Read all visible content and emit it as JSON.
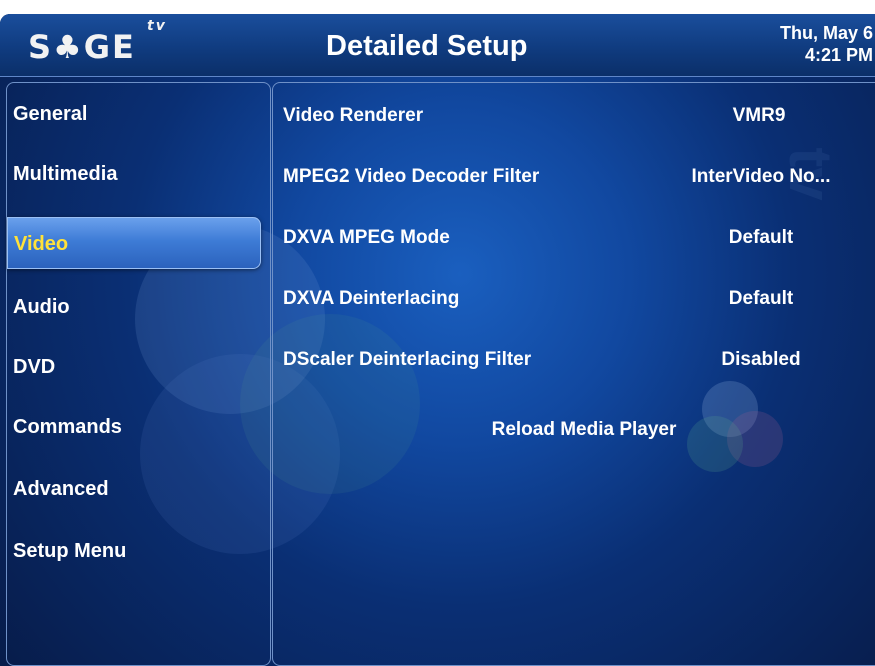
{
  "header": {
    "logo_text": "S♣GE",
    "logo_superscript": "tv",
    "title": "Detailed Setup",
    "date": "Thu, May 6",
    "time": "4:21 PM"
  },
  "menu": {
    "items": [
      {
        "label": "General"
      },
      {
        "label": "Multimedia"
      },
      {
        "label": "Video"
      },
      {
        "label": "Audio"
      },
      {
        "label": "DVD"
      },
      {
        "label": "Commands"
      },
      {
        "label": "Advanced"
      },
      {
        "label": "Setup Menu"
      }
    ],
    "selected": "Video"
  },
  "settings": {
    "rows": [
      {
        "label": "Video Renderer",
        "value": "VMR9"
      },
      {
        "label": "MPEG2 Video Decoder Filter",
        "value": "InterVideo No..."
      },
      {
        "label": "DXVA MPEG Mode",
        "value": "Default"
      },
      {
        "label": "DXVA Deinterlacing",
        "value": "Default"
      },
      {
        "label": "DScaler Deinterlacing Filter",
        "value": "Disabled"
      }
    ],
    "action": "Reload Media Player"
  },
  "colors": {
    "background": "#0b2a63",
    "selected_text": "#ffe23a",
    "selected_fill": "#3e7cd6",
    "text": "#ffffff"
  }
}
